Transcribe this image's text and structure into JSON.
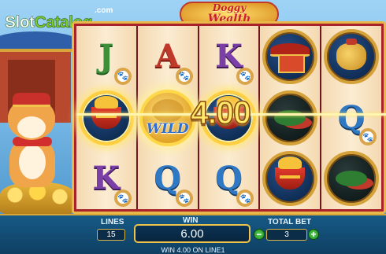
{
  "watermark": {
    "main_a": "Slot",
    "main_b": "Catalog",
    "suffix": ".com"
  },
  "logo": {
    "line1": "Doggy",
    "line2": "Wealth"
  },
  "reels": [
    [
      "J",
      "bowl",
      "K"
    ],
    [
      "A",
      "wild",
      "Q"
    ],
    [
      "K",
      "bowl",
      "Q"
    ],
    [
      "house",
      "pepper",
      "bowl"
    ],
    [
      "bag",
      "Q",
      "pepper"
    ]
  ],
  "symbols": {
    "wild_text": "WILD"
  },
  "win_overlay": {
    "amount": "4.00"
  },
  "controls": {
    "lines_label": "LINES",
    "lines_value": "15",
    "win_label": "WIN",
    "win_value": "6.00",
    "total_bet_label": "TOTAL BET",
    "total_bet_value": "3",
    "minus": "−",
    "plus": "+"
  },
  "status": "WIN 4.00 ON LINE1",
  "colors": {
    "frame": "#a9212a",
    "gold": "#e9b84a",
    "panel": "#165a86",
    "win_text": "#ffe86a"
  }
}
